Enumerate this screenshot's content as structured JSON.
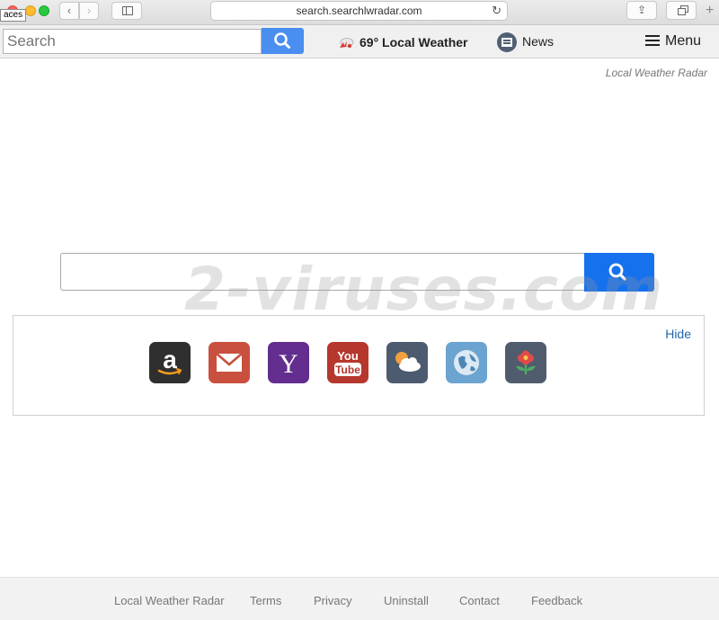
{
  "browser": {
    "spaces_label": "aces",
    "url": "search.searchlwradar.com"
  },
  "toolbar": {
    "search_placeholder": "Search",
    "weather_label": "69° Local Weather",
    "news_label": "News",
    "menu_label": "Menu"
  },
  "brand": {
    "name": "Local Weather Radar"
  },
  "watermark": {
    "text": "2-viruses.com"
  },
  "shortcuts": {
    "hide_label": "Hide",
    "tiles": [
      {
        "name": "amazon",
        "icon": "amazon-icon",
        "color": "#2f2f2f"
      },
      {
        "name": "mail",
        "icon": "mail-icon",
        "color": "#c9503e"
      },
      {
        "name": "yahoo",
        "icon": "yahoo-icon",
        "color": "#632e8f"
      },
      {
        "name": "youtube",
        "icon": "youtube-icon",
        "color": "#b6372d",
        "text_top": "You",
        "text_bottom": "Tube"
      },
      {
        "name": "weather",
        "icon": "weather-icon",
        "color": "#4d5b70"
      },
      {
        "name": "globe",
        "icon": "globe-icon",
        "color": "#6ba4d0"
      },
      {
        "name": "flower",
        "icon": "flower-icon",
        "color": "#505c6e"
      }
    ]
  },
  "footer": {
    "links": [
      "Local Weather Radar",
      "Terms",
      "Privacy",
      "Uninstall",
      "Contact",
      "Feedback"
    ]
  },
  "colors": {
    "search_button": "#4a8ef0",
    "main_search_button": "#1671ee",
    "link": "#2066b0"
  }
}
